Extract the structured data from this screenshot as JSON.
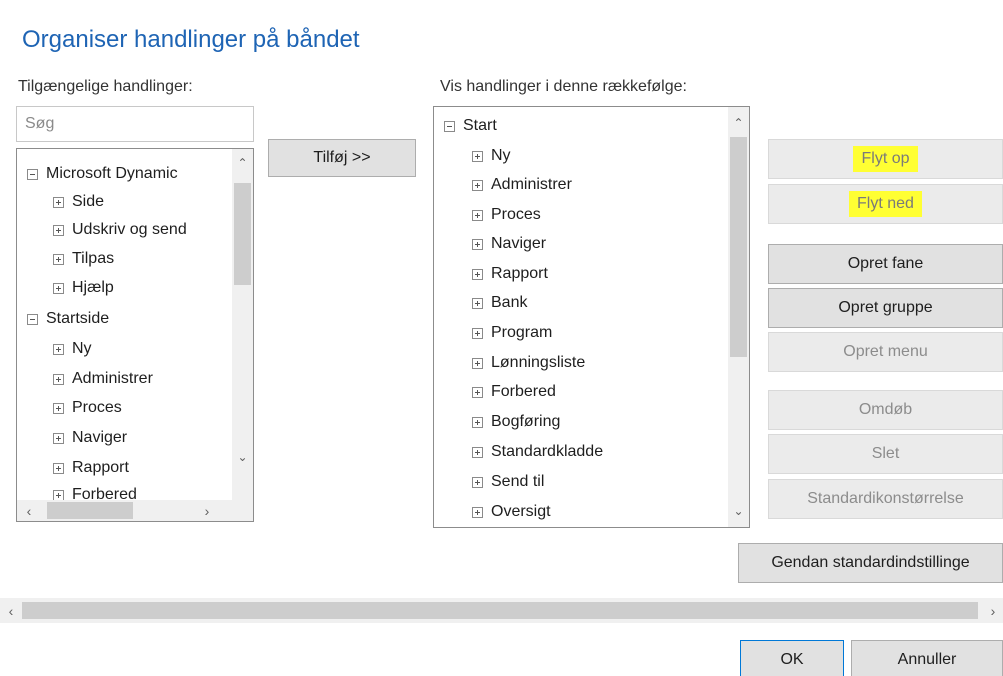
{
  "dialog": {
    "title": "Organiser handlinger på båndet"
  },
  "available": {
    "label": "Tilgængelige handlinger:",
    "search_placeholder": "Søg",
    "items": [
      {
        "label": "Microsoft Dynamic",
        "expanded": true,
        "level": 0
      },
      {
        "label": "Side",
        "expanded": false,
        "level": 1
      },
      {
        "label": "Udskriv og send",
        "expanded": false,
        "level": 1
      },
      {
        "label": "Tilpas",
        "expanded": false,
        "level": 1
      },
      {
        "label": "Hjælp",
        "expanded": false,
        "level": 1
      },
      {
        "label": "Startside",
        "expanded": true,
        "level": 0
      },
      {
        "label": "Ny",
        "expanded": false,
        "level": 1
      },
      {
        "label": "Administrer",
        "expanded": false,
        "level": 1
      },
      {
        "label": "Proces",
        "expanded": false,
        "level": 1
      },
      {
        "label": "Naviger",
        "expanded": false,
        "level": 1
      },
      {
        "label": "Rapport",
        "expanded": false,
        "level": 1
      },
      {
        "label": "Forbered",
        "expanded": false,
        "level": 1
      }
    ]
  },
  "add_button": {
    "label": "Tilføj >>"
  },
  "order": {
    "label": "Vis handlinger i denne rækkefølge:",
    "items": [
      {
        "label": "Start",
        "expanded": true,
        "level": 0
      },
      {
        "label": "Ny",
        "expanded": false,
        "level": 1
      },
      {
        "label": "Administrer",
        "expanded": false,
        "level": 1
      },
      {
        "label": "Proces",
        "expanded": false,
        "level": 1
      },
      {
        "label": "Naviger",
        "expanded": false,
        "level": 1
      },
      {
        "label": "Rapport",
        "expanded": false,
        "level": 1
      },
      {
        "label": "Bank",
        "expanded": false,
        "level": 1
      },
      {
        "label": "Program",
        "expanded": false,
        "level": 1
      },
      {
        "label": "Lønningsliste",
        "expanded": false,
        "level": 1
      },
      {
        "label": "Forbered",
        "expanded": false,
        "level": 1
      },
      {
        "label": "Bogføring",
        "expanded": false,
        "level": 1
      },
      {
        "label": "Standardkladde",
        "expanded": false,
        "level": 1
      },
      {
        "label": "Send til",
        "expanded": false,
        "level": 1
      },
      {
        "label": "Oversigt",
        "expanded": false,
        "level": 1
      }
    ]
  },
  "actions": {
    "move_up": "Flyt op",
    "move_down": "Flyt ned",
    "create_tab": "Opret fane",
    "create_group": "Opret gruppe",
    "create_menu": "Opret menu",
    "rename": "Omdøb",
    "delete": "Slet",
    "default_icon_size": "Standardikonstørrelse",
    "restore_defaults": "Gendan standardindstillinge"
  },
  "footer": {
    "ok": "OK",
    "cancel": "Annuller"
  },
  "highlight_color": "#ffff33",
  "title_color": "#1e64b4"
}
